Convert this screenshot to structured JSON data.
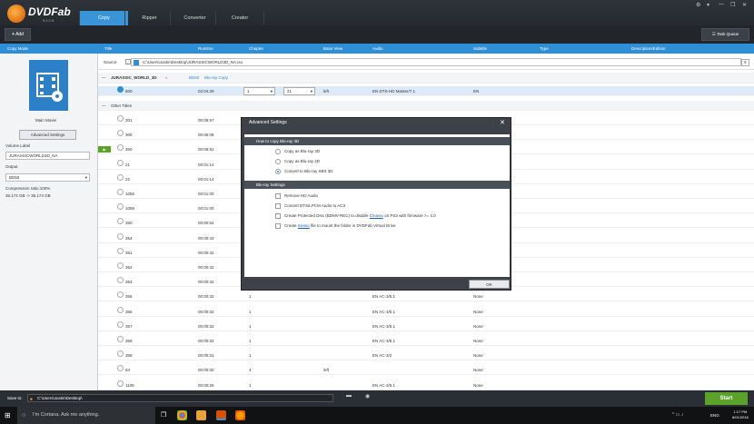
{
  "app": {
    "brand": "DVDFab",
    "version": "9.2.2.5"
  },
  "tabs": [
    "Copy",
    "Ripper",
    "Converter",
    "Creator"
  ],
  "toolbar": {
    "add": "Add",
    "task_queue": "Task Queue"
  },
  "columns": [
    "Copy Mode",
    "Title",
    "Runtime",
    "Chapter",
    "Base View",
    "Audio",
    "Subtitle",
    "Type",
    "Description/Edition"
  ],
  "left": {
    "mode_label": "Main Movie",
    "adv_btn": "Advanced Settings",
    "vol_label": "Volume Label",
    "vol_value": "JURASSICWORLD3D_NA",
    "output_label": "Output",
    "output_value": "BD50",
    "ratio": "Compression ratio:100%",
    "size": "36.174 GB -> 36.174 GB"
  },
  "source": {
    "label": "Source:",
    "path": "C:\\Users\\Justin\\Desktop\\JURASSICWORLD3D_NA.iso"
  },
  "disc": {
    "title": "JURASSIC_WORLD_3D",
    "bd": "BD50",
    "type": "Blu-ray Copy"
  },
  "main_title": {
    "title": "800",
    "runtime": "02:04:29",
    "chapter": "1",
    "base": "21",
    "view": "left",
    "audio": "EN  DTS-HD Master/7.1",
    "subtitle": "EN"
  },
  "other_titles_label": "Other Titles",
  "rows": [
    {
      "t": "301",
      "r": "00:08:57",
      "c": "",
      "v": "",
      "a": "",
      "s": ""
    },
    {
      "t": "300",
      "r": "00:06:08",
      "c": "",
      "v": "",
      "a": "",
      "s": ""
    },
    {
      "t": "360",
      "r": "00:05:52",
      "c": "",
      "v": "",
      "a": "",
      "s": ""
    },
    {
      "t": "21",
      "r": "00:01:14",
      "c": "",
      "v": "",
      "a": "",
      "s": ""
    },
    {
      "t": "22",
      "r": "00:01:14",
      "c": "",
      "v": "",
      "a": "",
      "s": ""
    },
    {
      "t": "1055",
      "r": "00:01:00",
      "c": "",
      "v": "",
      "a": "",
      "s": ""
    },
    {
      "t": "1056",
      "r": "00:01:00",
      "c": "",
      "v": "",
      "a": "",
      "s": ""
    },
    {
      "t": "350",
      "r": "00:00:52",
      "c": "",
      "v": "",
      "a": "",
      "s": ""
    },
    {
      "t": "354",
      "r": "00:00:44",
      "c": "",
      "v": "",
      "a": "",
      "s": ""
    },
    {
      "t": "351",
      "r": "00:00:32",
      "c": "",
      "v": "",
      "a": "",
      "s": ""
    },
    {
      "t": "352",
      "r": "00:00:32",
      "c": "",
      "v": "",
      "a": "",
      "s": ""
    },
    {
      "t": "353",
      "r": "00:00:32",
      "c": "",
      "v": "",
      "a": "",
      "s": ""
    },
    {
      "t": "355",
      "r": "00:00:32",
      "c": "1",
      "v": "",
      "a": "EN  AC-3/5.1",
      "s": "None"
    },
    {
      "t": "356",
      "r": "00:00:32",
      "c": "1",
      "v": "",
      "a": "EN  AC-3/5.1",
      "s": "None"
    },
    {
      "t": "357",
      "r": "00:00:32",
      "c": "1",
      "v": "",
      "a": "EN  AC-3/5.1",
      "s": "None"
    },
    {
      "t": "359",
      "r": "00:00:32",
      "c": "1",
      "v": "",
      "a": "EN  AC-3/5.1",
      "s": "None"
    },
    {
      "t": "358",
      "r": "00:00:31",
      "c": "1",
      "v": "",
      "a": "EN  AC-3/2",
      "s": "None"
    },
    {
      "t": "84",
      "r": "00:00:30",
      "c": "4",
      "v": "left",
      "a": "",
      "s": "None"
    },
    {
      "t": "1106",
      "r": "00:00:26",
      "c": "1",
      "v": "",
      "a": "EN  AC-3/5.1",
      "s": "None"
    }
  ],
  "dialog": {
    "title": "Advanced Settings",
    "sect1": "How to copy Blu-ray 3D",
    "opt1": "Copy as Blu-ray 3D",
    "opt2": "Copy as Blu-ray 2D",
    "opt3": "Convert to Blu-ray SBS 3D",
    "sect2": "Blu-ray Settings",
    "cb1": "Remove HD Audio",
    "cb2": "Convert DTS/LPCM Audio to AC3",
    "cb3_a": "Create Protected Disc (BDMV-REC) to disable ",
    "cb3_link": "Cinavia",
    "cb3_b": " on PS3 with firmware >= 4.0",
    "cb4_a": "Create ",
    "cb4_link": "miniso",
    "cb4_b": " file to mount the folder in DVDFab Virtual Drive",
    "ok": "OK"
  },
  "bottom": {
    "save_to": "Save to:",
    "path": "C:\\Users\\Justin\\Desktop\\",
    "start": "Start"
  },
  "taskbar": {
    "cortana": "I'm Cortana. Ask me anything.",
    "lang": "ENG",
    "time": "1:17 PM",
    "date": "8/01/2016"
  }
}
